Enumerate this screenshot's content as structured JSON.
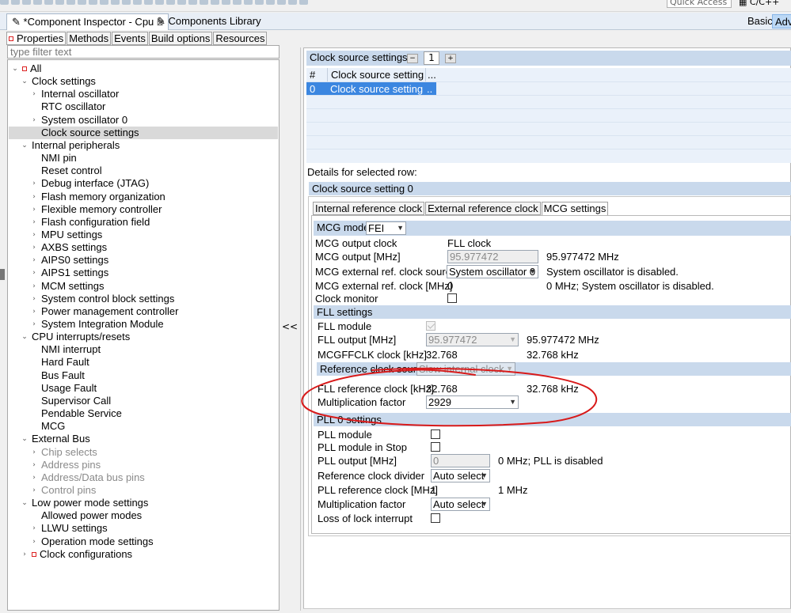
{
  "toolbar": {
    "quick_access_placeholder": "Quick Access",
    "perspective_label": "C/C++"
  },
  "editor_tabs": [
    {
      "label": "*Component Inspector - Cpu",
      "close": "⊠"
    },
    {
      "label": "Components Library"
    }
  ],
  "view_buttons": {
    "basic": "Basic",
    "advanced": "Adv"
  },
  "property_tabs": [
    "Properties",
    "Methods",
    "Events",
    "Build options",
    "Resources"
  ],
  "filter_placeholder": "type filter text",
  "tree": [
    {
      "label": "All",
      "level": 0,
      "arrow": "⌄",
      "redx": true
    },
    {
      "label": "Clock settings",
      "level": 1,
      "arrow": "⌄"
    },
    {
      "label": "Internal oscillator",
      "level": 2,
      "arrow": "›"
    },
    {
      "label": "RTC oscillator",
      "level": 2,
      "arrow": ""
    },
    {
      "label": "System oscillator 0",
      "level": 2,
      "arrow": "›"
    },
    {
      "label": "Clock source settings",
      "level": 2,
      "arrow": "",
      "selected": true
    },
    {
      "label": "Internal peripherals",
      "level": 1,
      "arrow": "⌄"
    },
    {
      "label": "NMI pin",
      "level": 2,
      "arrow": ""
    },
    {
      "label": "Reset control",
      "level": 2,
      "arrow": ""
    },
    {
      "label": "Debug interface (JTAG)",
      "level": 2,
      "arrow": "›"
    },
    {
      "label": "Flash memory organization",
      "level": 2,
      "arrow": "›"
    },
    {
      "label": "Flexible memory controller",
      "level": 2,
      "arrow": "›"
    },
    {
      "label": "Flash configuration field",
      "level": 2,
      "arrow": "›"
    },
    {
      "label": "MPU settings",
      "level": 2,
      "arrow": "›"
    },
    {
      "label": "AXBS settings",
      "level": 2,
      "arrow": "›"
    },
    {
      "label": "AIPS0 settings",
      "level": 2,
      "arrow": "›"
    },
    {
      "label": "AIPS1 settings",
      "level": 2,
      "arrow": "›"
    },
    {
      "label": "MCM settings",
      "level": 2,
      "arrow": "›"
    },
    {
      "label": "System control block settings",
      "level": 2,
      "arrow": "›"
    },
    {
      "label": "Power management controller",
      "level": 2,
      "arrow": "›"
    },
    {
      "label": "System Integration Module",
      "level": 2,
      "arrow": "›"
    },
    {
      "label": "CPU interrupts/resets",
      "level": 1,
      "arrow": "⌄"
    },
    {
      "label": "NMI interrupt",
      "level": 2,
      "arrow": ""
    },
    {
      "label": "Hard Fault",
      "level": 2,
      "arrow": ""
    },
    {
      "label": "Bus Fault",
      "level": 2,
      "arrow": ""
    },
    {
      "label": "Usage Fault",
      "level": 2,
      "arrow": ""
    },
    {
      "label": "Supervisor Call",
      "level": 2,
      "arrow": ""
    },
    {
      "label": "Pendable Service",
      "level": 2,
      "arrow": ""
    },
    {
      "label": "MCG",
      "level": 2,
      "arrow": ""
    },
    {
      "label": "External Bus",
      "level": 1,
      "arrow": "⌄"
    },
    {
      "label": "Chip selects",
      "level": 2,
      "arrow": "›",
      "disabled": true
    },
    {
      "label": "Address pins",
      "level": 2,
      "arrow": "›",
      "disabled": true
    },
    {
      "label": "Address/Data bus pins",
      "level": 2,
      "arrow": "›",
      "disabled": true
    },
    {
      "label": "Control pins",
      "level": 2,
      "arrow": "›",
      "disabled": true
    },
    {
      "label": "Low power mode settings",
      "level": 1,
      "arrow": "⌄"
    },
    {
      "label": "Allowed power modes",
      "level": 2,
      "arrow": ""
    },
    {
      "label": "LLWU settings",
      "level": 2,
      "arrow": "›"
    },
    {
      "label": "Operation mode settings",
      "level": 2,
      "arrow": "›"
    },
    {
      "label": "Clock configurations",
      "level": 1,
      "arrow": "›",
      "redx": true
    }
  ],
  "collapse_label": "<<",
  "clock_source": {
    "header": "Clock source settings",
    "minus": "−",
    "count": "1",
    "plus": "+",
    "columns": [
      "#",
      "Clock source setting",
      "..."
    ],
    "rows": [
      {
        "index": "0",
        "name": "Clock source setting 0",
        "extra": ".."
      }
    ]
  },
  "details_label": "Details for selected row:",
  "detail_header": "Clock source setting 0",
  "sub_tabs": [
    "Internal reference clock",
    "External reference clock",
    "MCG settings"
  ],
  "mcg": {
    "mode_label": "MCG mode",
    "mode_value": "FEI",
    "rows": [
      {
        "label": "MCG output clock",
        "value": "FLL clock"
      },
      {
        "label": "MCG output [MHz]",
        "value": "95.977472",
        "note": "95.977472 MHz"
      },
      {
        "label": "MCG external ref. clock source",
        "value": "System oscillator 0",
        "note": "System oscillator is disabled."
      },
      {
        "label": "MCG external ref. clock [MHz]",
        "value": "0",
        "note": "0 MHz; System oscillator is disabled."
      },
      {
        "label": "Clock monitor"
      }
    ]
  },
  "fll": {
    "header": "FLL settings",
    "module_label": "FLL module",
    "output_label": "FLL output [MHz]",
    "output_value": "95.977472",
    "output_note": "95.977472 MHz",
    "mcgff_label": "MCGFFCLK clock [kHz]",
    "mcgff_value": "32.768",
    "mcgff_note": "32.768 kHz",
    "refsrc_label": "Reference clock source",
    "refsrc_value": "Slow internal clock",
    "refclk_label": "FLL reference clock [kHz]",
    "refclk_value": "32.768",
    "refclk_note": "32.768 kHz",
    "mult_label": "Multiplication factor",
    "mult_value": "2929"
  },
  "pll": {
    "header": "PLL 0 settings",
    "module_label": "PLL module",
    "stop_label": "PLL module in Stop",
    "output_label": "PLL output [MHz]",
    "output_value": "0",
    "output_note": "0 MHz; PLL is disabled",
    "div_label": "Reference clock divider",
    "div_value": "Auto select",
    "refclk_label": "PLL reference clock [MHz]",
    "refclk_value": "1",
    "refclk_note": "1 MHz",
    "mult_label": "Multiplication factor",
    "mult_value": "Auto select",
    "lol_label": "Loss of lock interrupt"
  },
  "colors": {
    "selection": "#3b86e0",
    "header_bg": "#c9d9ec",
    "annotation": "#d81a1a"
  }
}
